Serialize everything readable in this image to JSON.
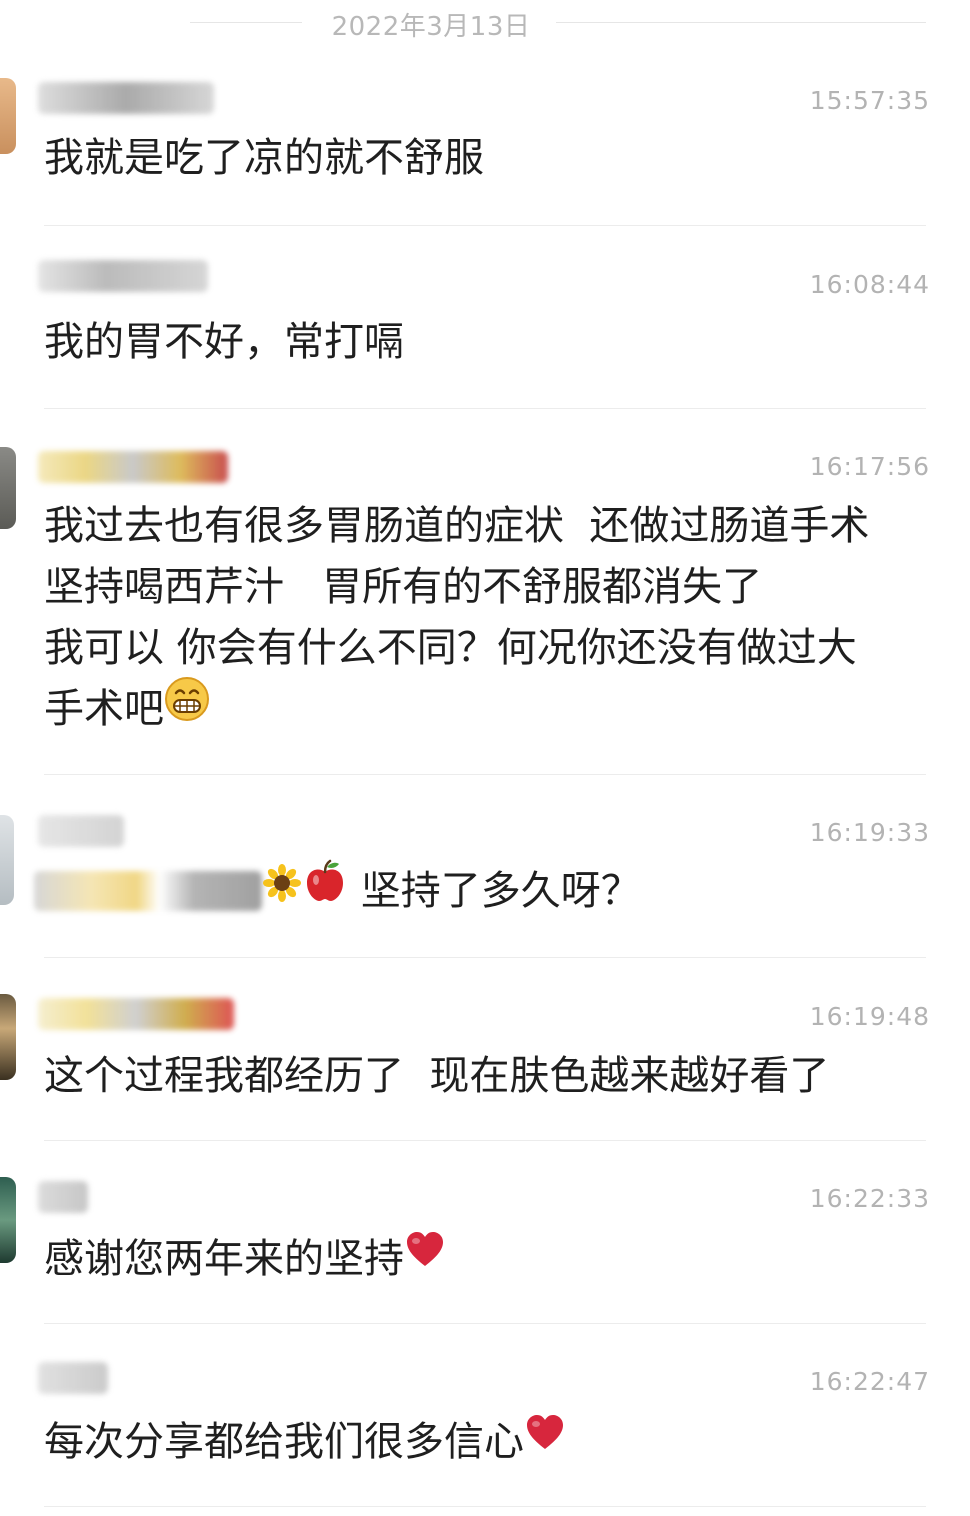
{
  "date_header": "2022年3月13日",
  "comments": [
    {
      "time": "15:57:35",
      "text": "我就是吃了凉的就不舒服"
    },
    {
      "time": "16:08:44",
      "text": "我的胃不好，常打嗝"
    },
    {
      "time": "16:17:56",
      "lines": [
        "我过去也有很多胃肠道的症状  还做过肠道手术",
        "坚持喝西芹汁   胃所有的不舒服都消失了",
        "我可以 你会有什么不同？何况你还没有做过大",
        "手术吧"
      ],
      "trailing_emoji": "grin-icon"
    },
    {
      "time": "16:19:33",
      "text": "坚持了多久呀？",
      "prefix_emoji": "apple-icon"
    },
    {
      "time": "16:19:48",
      "text": "这个过程我都经历了  现在肤色越来越好看了"
    },
    {
      "time": "16:22:33",
      "text": "感谢您两年来的坚持",
      "trailing_emoji": "heart-icon"
    },
    {
      "time": "16:22:47",
      "text": "每次分享都给我们很多信心",
      "trailing_emoji": "heart-icon"
    }
  ],
  "colors": {
    "timestamp": "#b3b3b3",
    "divider": "#ececec",
    "text": "#1f1f1f",
    "heart": "#d7263d"
  }
}
